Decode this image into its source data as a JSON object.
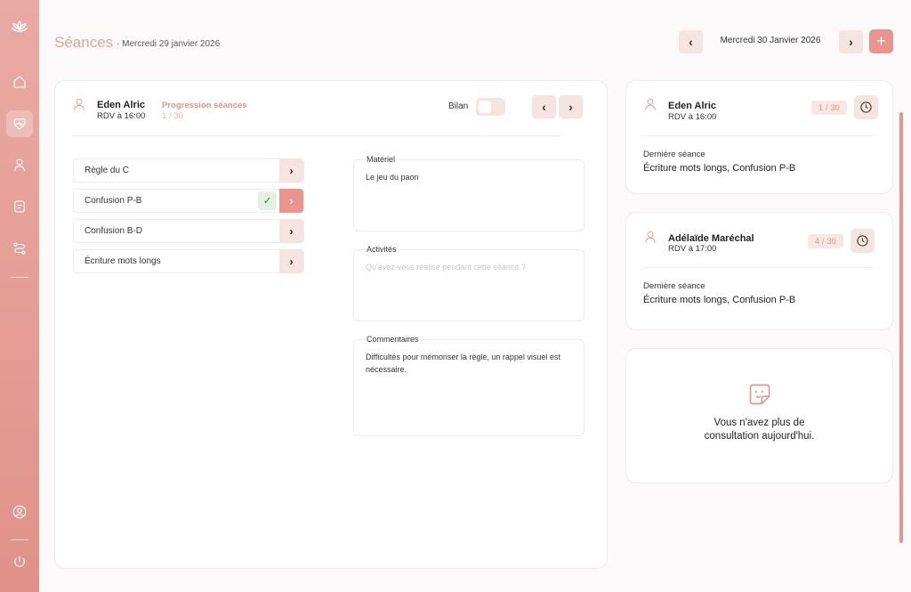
{
  "sidebar": {
    "items": [
      {
        "name": "lotus-logo-icon"
      },
      {
        "name": "home-icon"
      },
      {
        "name": "heart-pulse-icon"
      },
      {
        "name": "user-icon"
      },
      {
        "name": "document-icon"
      },
      {
        "name": "route-icon"
      },
      {
        "name": "account-icon"
      },
      {
        "name": "power-icon"
      }
    ]
  },
  "header": {
    "title": "Séances",
    "subtitle": "· Mercredi 29 janvier 2026",
    "current_date": "Mercredi 30 Janvier 2026",
    "prev": "‹",
    "next": "›",
    "add": "+"
  },
  "main": {
    "patient_name": "Eden Alric",
    "rdv": "RDV à 16:00",
    "progress_label": "Progression séances",
    "progress_value": "1 / 30",
    "bilan_label": "Bilan",
    "nav_prev": "‹",
    "nav_next": "›",
    "exercises": [
      {
        "label": "Règle du C",
        "chev": "›"
      },
      {
        "label": "Confusion P-B",
        "chev": "›",
        "check": "✓"
      },
      {
        "label": "Confusion B-D",
        "chev": "›"
      },
      {
        "label": "Écriture mots longs",
        "chev": "›"
      }
    ],
    "materiel_label": "Matériel",
    "materiel_value": "Le jeu du paon",
    "activites_label": "Activités",
    "activites_placeholder": "Qu'avez-vous réalisé pendant cette séance ?",
    "commentaires_label": "Commentaires",
    "commentaires_value": "Difficultés pour mémoriser la règle, un rappel visuel est nécessaire."
  },
  "appointments": [
    {
      "name": "Eden Alric",
      "rdv": "RDV à 16:00",
      "progress": "1 / 30",
      "last_label": "Dernière séance",
      "last_value": "Écriture mots longs, Confusion P-B"
    },
    {
      "name": "Adélaïde Maréchal",
      "rdv": "RDV à 17:00",
      "progress": "4 / 30",
      "last_label": "Dernière séance",
      "last_value": "Écriture mots longs, Confusion P-B"
    }
  ],
  "empty_state": {
    "line1": "Vous n'avez plus de",
    "line2": "consultation aujourd'hui."
  },
  "colors": {
    "accent": "#e9948d",
    "accent_light": "#f6e4e1",
    "title": "#e0a49d"
  }
}
